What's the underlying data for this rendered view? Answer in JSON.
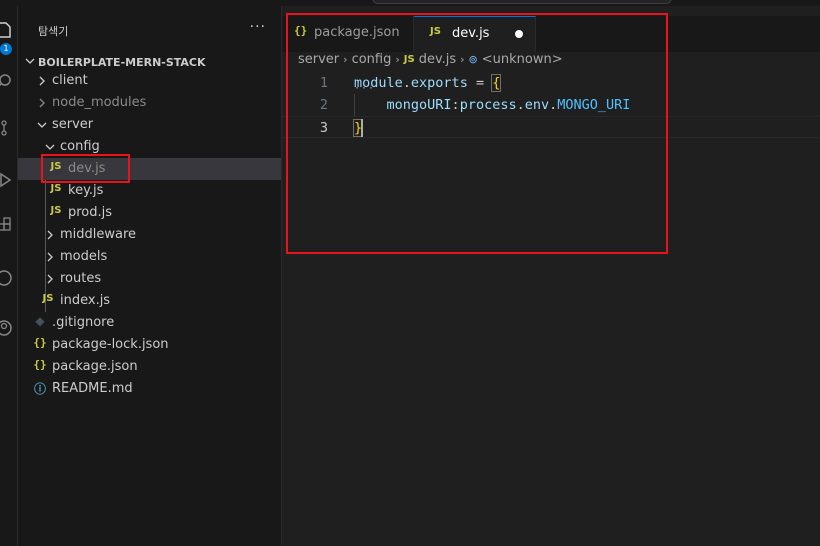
{
  "explorer": {
    "title": "탐색기",
    "more_label": "···",
    "project_name": "BOILERPLATE-MERN-STACK",
    "tree": [
      {
        "name": "client",
        "type": "folder",
        "expanded": false,
        "depth": 0
      },
      {
        "name": "node_modules",
        "type": "folder",
        "expanded": false,
        "depth": 0,
        "dimmed": true
      },
      {
        "name": "server",
        "type": "folder",
        "expanded": true,
        "depth": 0
      },
      {
        "name": "config",
        "type": "folder",
        "expanded": true,
        "depth": 1
      },
      {
        "name": "dev.js",
        "type": "js",
        "depth": 2,
        "selected": true,
        "icon": "JS"
      },
      {
        "name": "key.js",
        "type": "js",
        "depth": 2,
        "icon": "JS"
      },
      {
        "name": "prod.js",
        "type": "js",
        "depth": 2,
        "icon": "JS"
      },
      {
        "name": "middleware",
        "type": "folder",
        "expanded": false,
        "depth": 1
      },
      {
        "name": "models",
        "type": "folder",
        "expanded": false,
        "depth": 1
      },
      {
        "name": "routes",
        "type": "folder",
        "expanded": false,
        "depth": 1
      },
      {
        "name": "index.js",
        "type": "js",
        "depth": 1,
        "icon": "JS"
      },
      {
        "name": ".gitignore",
        "type": "git",
        "depth": 0,
        "icon": "◆"
      },
      {
        "name": "package-lock.json",
        "type": "json",
        "depth": 0,
        "icon": "{}"
      },
      {
        "name": "package.json",
        "type": "json",
        "depth": 0,
        "icon": "{}"
      },
      {
        "name": "README.md",
        "type": "md",
        "depth": 0,
        "icon": "ⓘ"
      }
    ]
  },
  "activity_bar": {
    "badge": "1",
    "icons": [
      "files-icon",
      "search-icon",
      "source-control-icon",
      "run-debug-icon",
      "extensions-icon",
      "remote-icon",
      "account-icon"
    ]
  },
  "tabs": [
    {
      "label": "package.json",
      "icon": "{}",
      "active": false
    },
    {
      "label": "dev.js",
      "icon": "JS",
      "active": true,
      "modified": true
    }
  ],
  "breadcrumb": {
    "parts": [
      "server",
      "config",
      "dev.js",
      "<unknown>"
    ],
    "file_icon": "JS"
  },
  "code": {
    "line_numbers": [
      "1",
      "2",
      "3"
    ],
    "line1": {
      "a": "module",
      "b": ".",
      "c": "exports",
      "d": " = ",
      "e": "{"
    },
    "line2": {
      "a": "mongoURI",
      "b": ":",
      "c": "process",
      "d": ".",
      "e": "env",
      "f": ".",
      "g": "MONGO_URI"
    },
    "line3": {
      "a": "}"
    },
    "active_line": 3
  },
  "colors": {
    "accent": "#0078d4",
    "annotation": "#e8141b",
    "js_icon": "#cbcb41",
    "background": "#1f1f1f",
    "sidebar": "#181818"
  }
}
